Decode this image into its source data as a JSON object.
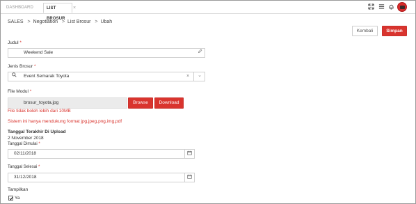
{
  "tabs": {
    "dashboard": "DASHBOARD",
    "list_brosur": "LIST BROSUR",
    "close": "×"
  },
  "toolbar_icons": [
    "expand-icon",
    "menu-icon",
    "bell-icon",
    "avatar"
  ],
  "breadcrumb": {
    "items": [
      "SALES",
      "Negotiation",
      "List Brosur",
      "Ubah"
    ],
    "separator": ">"
  },
  "actions": {
    "kembali": "Kembali",
    "simpan": "Simpan"
  },
  "form": {
    "judul": {
      "label": "Judul",
      "required": "*",
      "value": "Weekend Sale"
    },
    "jenis_brosur": {
      "label": "Jenis Brosur",
      "required": "*",
      "value": "Event Semarak Toyota",
      "clear": "×",
      "caret": "⌄"
    },
    "file_modul": {
      "label": "File Modul",
      "required": "*",
      "value": "brosur_toyota.jpg",
      "browse": "Browse",
      "download": "Download",
      "note_size": "File tidak boleh lebih dari 10MB",
      "note_format": "Sistem ini hanya mendukung format jpg,jpeg,png,img,pdf"
    },
    "tanggal_upload": {
      "label": "Tanggal Terakhir Di Upload",
      "value": "2 November 2018"
    },
    "tanggal_dimulai": {
      "label": "Tanggal Dimulai",
      "required": "*",
      "value": "02/11/2018"
    },
    "tanggal_selesai": {
      "label": "Tanggal Selesai",
      "required": "*",
      "value": "31/12/2018"
    },
    "tampilkan": {
      "label": "Tampilkan",
      "option": "Ya",
      "checked": true
    }
  },
  "colors": {
    "accent": "#d9342e",
    "border": "#cfcfcf"
  }
}
